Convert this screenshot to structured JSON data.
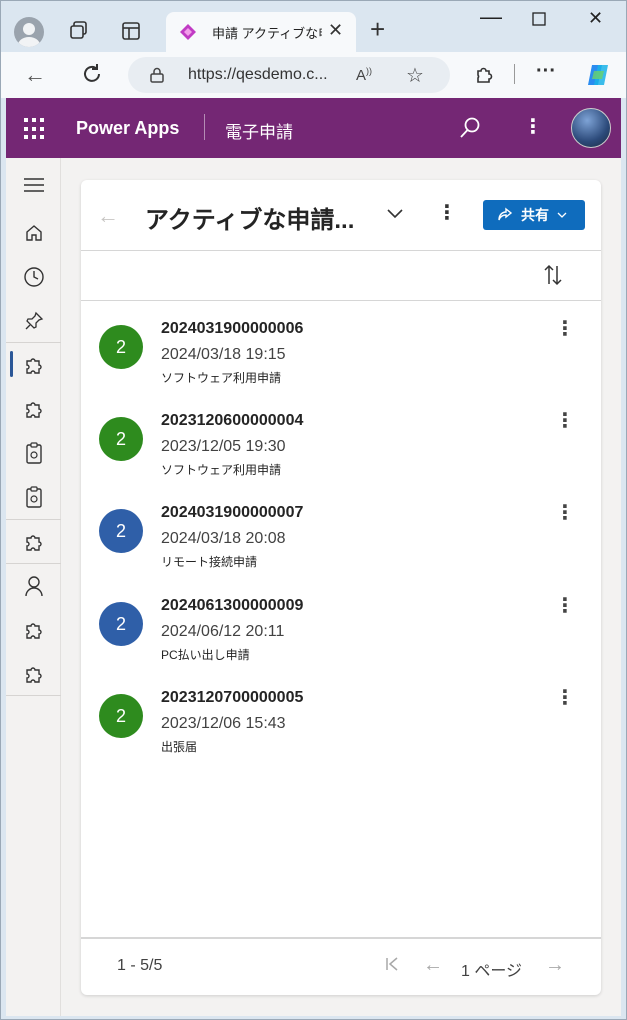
{
  "browser": {
    "tab_title": "申請 アクティブな申請",
    "url": "https://qesdemo.c...",
    "read_aloud": "A",
    "colors": {
      "chrome_bg": "#dbe6f0",
      "toolbar_bg": "#f7f9fb"
    }
  },
  "app": {
    "name": "Power Apps",
    "subtitle": "電子申請",
    "header_color": "#742774"
  },
  "nav": {
    "items": [
      {
        "icon": "hamburger-icon"
      },
      {
        "icon": "home-icon"
      },
      {
        "icon": "recent-clock-icon"
      },
      {
        "icon": "pin-icon"
      },
      {
        "icon": "puzzle-icon",
        "active": true
      },
      {
        "icon": "puzzle-icon"
      },
      {
        "icon": "clipboard-icon"
      },
      {
        "icon": "clipboard-icon"
      },
      {
        "icon": "puzzle-icon"
      },
      {
        "icon": "person-icon"
      },
      {
        "icon": "puzzle-icon"
      },
      {
        "icon": "puzzle-icon"
      }
    ]
  },
  "view": {
    "title": "アクティブな申請...",
    "share_label": "共有",
    "share_color": "#0f6cbd"
  },
  "records": [
    {
      "avatar": "2",
      "color": "#2e8b1e",
      "id": "2024031900000006",
      "date": "2024/03/18 19:15",
      "type": "ソフトウェア利用申請"
    },
    {
      "avatar": "2",
      "color": "#2e8b1e",
      "id": "2023120600000004",
      "date": "2023/12/05 19:30",
      "type": "ソフトウェア利用申請"
    },
    {
      "avatar": "2",
      "color": "#2f5fa8",
      "id": "2024031900000007",
      "date": "2024/03/18 20:08",
      "type": "リモート接続申請"
    },
    {
      "avatar": "2",
      "color": "#2f5fa8",
      "id": "2024061300000009",
      "date": "2024/06/12 20:11",
      "type": "PC払い出し申請"
    },
    {
      "avatar": "2",
      "color": "#2e8b1e",
      "id": "2023120700000005",
      "date": "2023/12/06 15:43",
      "type": "出張届"
    }
  ],
  "pager": {
    "count": "1 - 5/5",
    "page": "1 ページ"
  }
}
